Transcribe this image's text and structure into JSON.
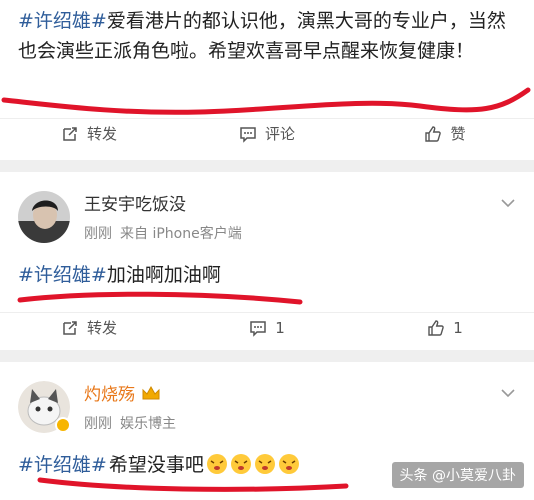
{
  "post": {
    "hashtag": "#许绍雄#",
    "text": "爱看港片的都认识他，演黑大哥的专业户，当然也会演些正派角色啦。希望欢喜哥早点醒来恢复健康！",
    "actions": {
      "repost": "转发",
      "comment": "评论",
      "like": "赞"
    }
  },
  "comment1": {
    "user_name": "王安宇吃饭没",
    "time": "刚刚",
    "source": "来自 iPhone客户端",
    "hashtag": "#许绍雄#",
    "text": "加油啊加油啊",
    "actions": {
      "repost": "转发",
      "comment_count": "1",
      "like_count": "1"
    }
  },
  "comment2": {
    "user_name": "灼烧殇",
    "time": "刚刚",
    "role": "娱乐博主",
    "hashtag": "#许绍雄#",
    "text": "希望没事吧"
  },
  "watermark": "头条 @小莫爱八卦",
  "colors": {
    "hashtag": "#2f5d9a",
    "annotation_red": "#e0142a",
    "vip_name": "#e8781a"
  }
}
